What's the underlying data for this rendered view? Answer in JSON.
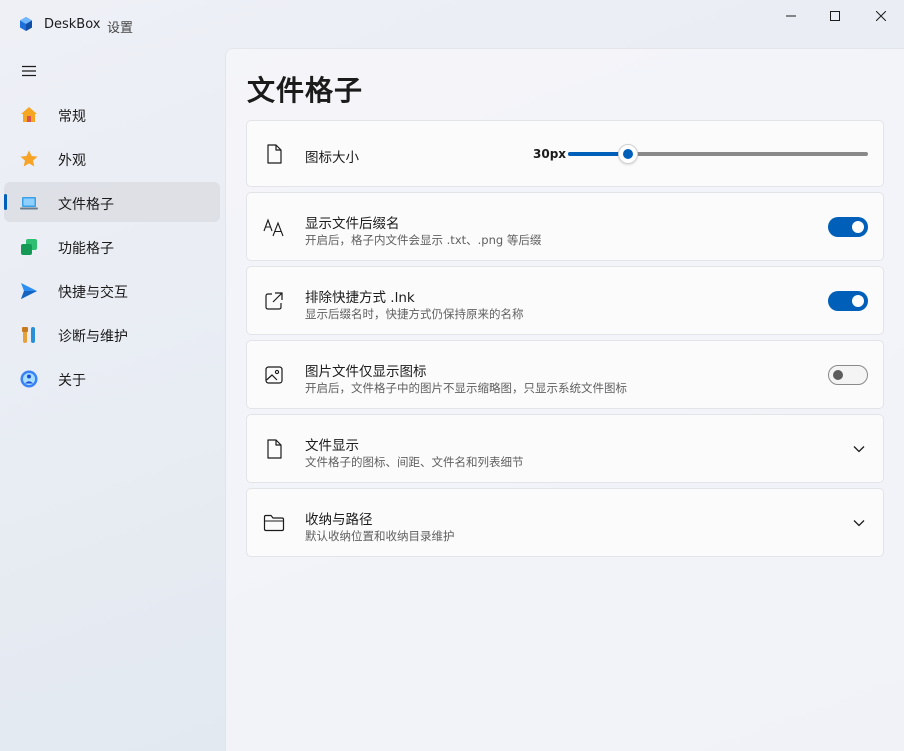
{
  "window": {
    "app_name": "DeskBox",
    "subtitle": "设置",
    "controls": [
      "minimize-icon",
      "maximize-icon",
      "close-icon"
    ]
  },
  "sidebar": {
    "menu_icon": "hamburger-icon",
    "items": [
      {
        "label": "常规",
        "icon": "home-icon",
        "active": false
      },
      {
        "label": "外观",
        "icon": "star-icon",
        "active": false
      },
      {
        "label": "文件格子",
        "icon": "laptop-icon",
        "active": true
      },
      {
        "label": "功能格子",
        "icon": "blocks-icon",
        "active": false
      },
      {
        "label": "快捷与交互",
        "icon": "send-icon",
        "active": false
      },
      {
        "label": "诊断与维护",
        "icon": "tools-icon",
        "active": false
      },
      {
        "label": "关于",
        "icon": "info-icon",
        "active": false
      }
    ]
  },
  "main": {
    "title": "文件格子",
    "settings": [
      {
        "type": "slider",
        "icon": "file-icon",
        "title": "图标大小",
        "value_label": "30px",
        "fill_fraction": 0.2
      },
      {
        "type": "toggle",
        "icon": "font-size-icon",
        "title": "显示文件后缀名",
        "desc": "开启后，格子内文件会显示 .txt、.png 等后缀",
        "on": true
      },
      {
        "type": "toggle",
        "icon": "open-external-icon",
        "title": "排除快捷方式 .lnk",
        "desc": "显示后缀名时，快捷方式仍保持原来的名称",
        "on": true
      },
      {
        "type": "toggle",
        "icon": "image-icon",
        "title": "图片文件仅显示图标",
        "desc": "开启后，文件格子中的图片不显示缩略图，只显示系统文件图标",
        "on": false
      },
      {
        "type": "expander",
        "icon": "file-icon",
        "title": "文件显示",
        "desc": "文件格子的图标、间距、文件名和列表细节"
      },
      {
        "type": "expander",
        "icon": "folder-icon",
        "title": "收纳与路径",
        "desc": "默认收纳位置和收纳目录维护"
      }
    ]
  },
  "colors": {
    "accent": "#005fb8",
    "card_bg": "#fbfbfc",
    "card_border": "#e3e4e8"
  }
}
